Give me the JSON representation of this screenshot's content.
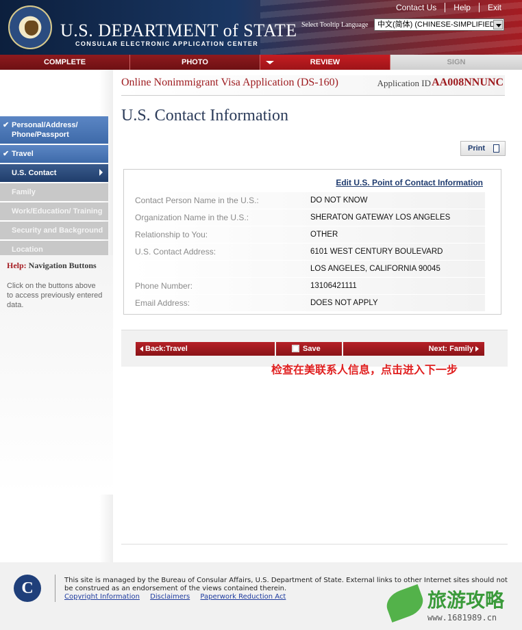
{
  "header": {
    "dept_title": "U.S. DEPARTMENT of STATE",
    "dept_subtitle": "CONSULAR ELECTRONIC APPLICATION CENTER",
    "links": [
      "Contact Us",
      "Help",
      "Exit"
    ],
    "tooltip_language_label": "Select Tooltip Language",
    "tooltip_language_value": "中文(简体) (CHINESE-SIMPLIFIED)"
  },
  "steps": [
    "COMPLETE",
    "PHOTO",
    "REVIEW",
    "SIGN"
  ],
  "sidebar": {
    "items": [
      {
        "label": "Personal/Address/ Phone/Passport",
        "state": "done"
      },
      {
        "label": "Travel",
        "state": "done"
      },
      {
        "label": "U.S. Contact",
        "state": "current"
      },
      {
        "label": "Family",
        "state": "todo"
      },
      {
        "label": "Work/Education/ Training",
        "state": "todo"
      },
      {
        "label": "Security and Background",
        "state": "todo"
      },
      {
        "label": "Location",
        "state": "todo"
      }
    ],
    "help_title_prefix": "Help:",
    "help_title": "Navigation Buttons",
    "help_text": "Click on the buttons above to access previously entered data."
  },
  "main": {
    "app_title": "Online Nonimmigrant Visa Application (DS-160)",
    "app_id_label": "Application ID",
    "app_id": "AA008NNUNC",
    "page_title": "U.S. Contact Information",
    "print_label": "Print",
    "edit_link": "Edit U.S. Point of Contact Information",
    "rows": [
      {
        "label": "Contact Person Name in the U.S.:",
        "value": "DO NOT KNOW"
      },
      {
        "label": "Organization Name in the U.S.:",
        "value": "SHERATON GATEWAY LOS ANGELES"
      },
      {
        "label": "Relationship to You:",
        "value": "OTHER"
      },
      {
        "label": "U.S. Contact Address:",
        "value": "6101 WEST CENTURY BOULEVARD"
      },
      {
        "label": "",
        "value": "LOS ANGELES, CALIFORNIA 90045"
      },
      {
        "label": "Phone Number:",
        "value": "13106421111"
      },
      {
        "label": "Email Address:",
        "value": "DOES NOT APPLY"
      }
    ],
    "back_label": "Back:Travel",
    "save_label": "Save",
    "next_label": "Next: Family",
    "annotation": "检查在美联系人信息，点击进入下一步"
  },
  "footer": {
    "logo_letter": "C",
    "text": "This site is managed by the Bureau of Consular Affairs, U.S. Department of State. External links to other Internet sites should not be construed as an endorsement of the views contained therein.",
    "links": [
      "Copyright Information",
      "Disclaimers",
      "Paperwork Reduction Act"
    ]
  },
  "watermark": {
    "main": "旅游攻略",
    "url": "www.1681989.cn"
  }
}
